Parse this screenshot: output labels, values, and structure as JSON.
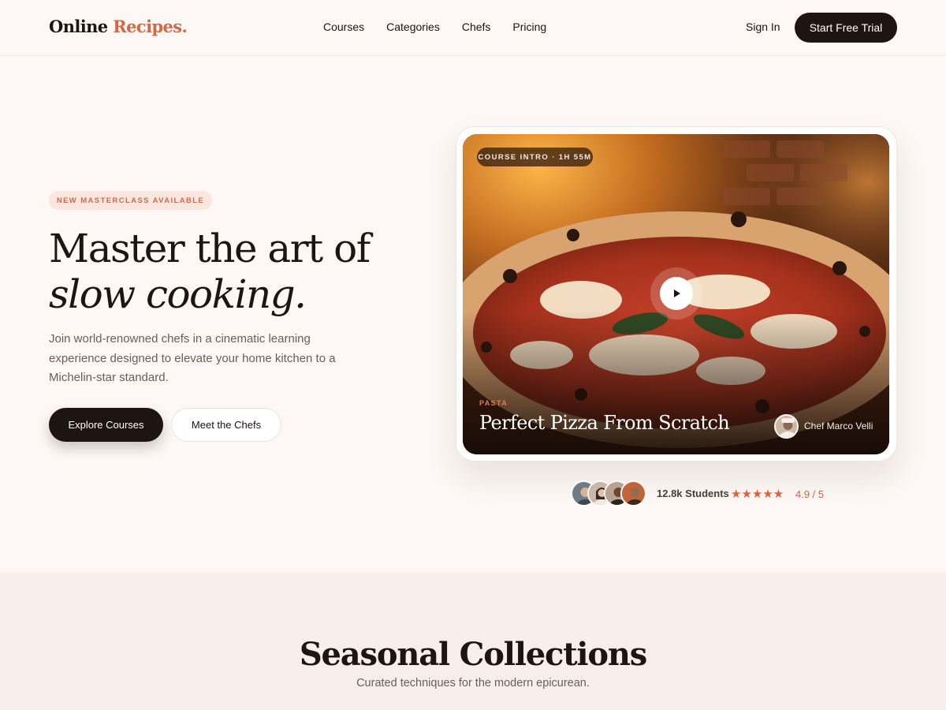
{
  "header": {
    "logo_main": "Online",
    "logo_accent": "Recipes.",
    "nav": [
      "Courses",
      "Categories",
      "Chefs",
      "Pricing"
    ],
    "sign_in": "Sign In",
    "cta": "Start Free Trial"
  },
  "hero": {
    "badge": "NEW MASTERCLASS AVAILABLE",
    "headline_line1": "Master the art of",
    "headline_line2": "slow cooking.",
    "lead": "Join world-renowned chefs in a cinematic learning experience designed to elevate your home kitchen to a Michelin-star standard.",
    "primary_button": "Explore Courses",
    "secondary_button": "Meet the Chefs"
  },
  "video_card": {
    "pill": "COURSE INTRO · 1H 55M",
    "category": "PASTA",
    "title": "Perfect Pizza From Scratch",
    "chef": "Chef Marco Velli",
    "play_icon": "play-icon"
  },
  "social_proof": {
    "students": "12.8k Students",
    "stars": "★★★★★",
    "rating": "4.9 / 5"
  },
  "seasonal": {
    "title": "Seasonal Collections",
    "subtitle": "Curated techniques for the modern epicurean."
  },
  "colors": {
    "background": "#fdf8f5",
    "dark": "#1e1412",
    "accent": "#cf6a47",
    "badge_bg": "#fbe6df",
    "section_bg": "#f8efeb"
  }
}
